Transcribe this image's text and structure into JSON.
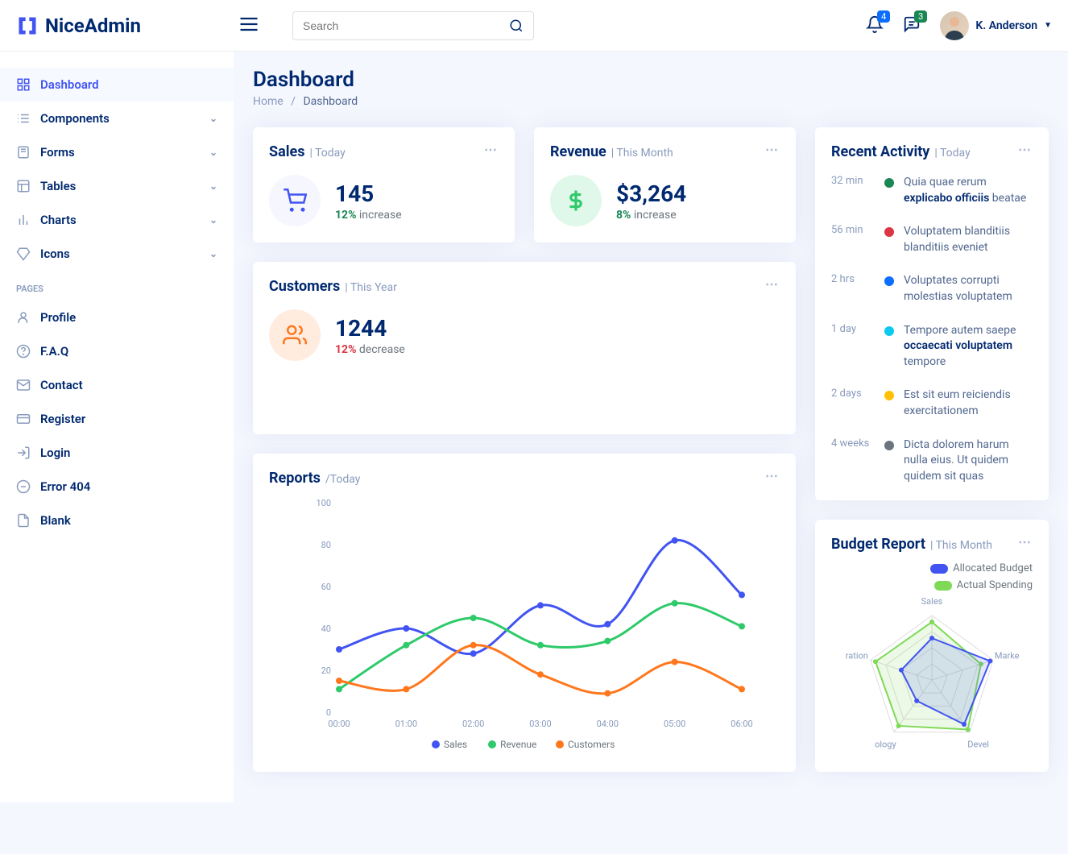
{
  "brand": "NiceAdmin",
  "search": {
    "placeholder": "Search"
  },
  "notifications": {
    "count": "4"
  },
  "messages": {
    "count": "3"
  },
  "user": {
    "name": "K. Anderson"
  },
  "sidebar": {
    "items": [
      {
        "label": "Dashboard",
        "icon": "grid",
        "active": true
      },
      {
        "label": "Components",
        "icon": "menu",
        "chevron": true
      },
      {
        "label": "Forms",
        "icon": "journal",
        "chevron": true
      },
      {
        "label": "Tables",
        "icon": "layout",
        "chevron": true
      },
      {
        "label": "Charts",
        "icon": "bar",
        "chevron": true
      },
      {
        "label": "Icons",
        "icon": "gem",
        "chevron": true
      }
    ],
    "pages_heading": "PAGES",
    "pages": [
      {
        "label": "Profile",
        "icon": "person"
      },
      {
        "label": "F.A.Q",
        "icon": "question"
      },
      {
        "label": "Contact",
        "icon": "envelope"
      },
      {
        "label": "Register",
        "icon": "card"
      },
      {
        "label": "Login",
        "icon": "login"
      },
      {
        "label": "Error 404",
        "icon": "dash"
      },
      {
        "label": "Blank",
        "icon": "file"
      }
    ]
  },
  "page": {
    "title": "Dashboard",
    "breadcrumb_home": "Home",
    "breadcrumb_sep": "/",
    "breadcrumb_current": "Dashboard"
  },
  "cards": {
    "sales": {
      "title": "Sales",
      "period": "Today",
      "value": "145",
      "pct": "12%",
      "trend": "increase",
      "direction": "up"
    },
    "revenue": {
      "title": "Revenue",
      "period": "This Month",
      "value": "$3,264",
      "pct": "8%",
      "trend": "increase",
      "direction": "up"
    },
    "customers": {
      "title": "Customers",
      "period": "This Year",
      "value": "1244",
      "pct": "12%",
      "trend": "decrease",
      "direction": "down"
    }
  },
  "reports": {
    "title": "Reports",
    "period": "/Today"
  },
  "activity": {
    "title": "Recent Activity",
    "period": "Today",
    "items": [
      {
        "time": "32 min",
        "color": "#198754",
        "text": "Quia quae rerum <strong>explicabo officiis</strong> beatae"
      },
      {
        "time": "56 min",
        "color": "#dc3545",
        "text": "Voluptatem blanditiis blanditiis eveniet"
      },
      {
        "time": "2 hrs",
        "color": "#0d6efd",
        "text": "Voluptates corrupti molestias voluptatem"
      },
      {
        "time": "1 day",
        "color": "#0dcaf0",
        "text": "Tempore autem saepe <strong>occaecati voluptatem</strong> tempore"
      },
      {
        "time": "2 days",
        "color": "#ffc107",
        "text": "Est sit eum reiciendis exercitationem"
      },
      {
        "time": "4 weeks",
        "color": "#6c757d",
        "text": "Dicta dolorem harum nulla eius. Ut quidem quidem sit quas"
      }
    ]
  },
  "budget": {
    "title": "Budget Report",
    "period": "This Month",
    "legend": [
      {
        "label": "Allocated Budget",
        "color": "#4154f1"
      },
      {
        "label": "Actual Spending",
        "color": "#7ed957"
      }
    ],
    "axes": [
      "Sales",
      "Marke",
      "Devel",
      "ology",
      "ration"
    ]
  },
  "chart_data": {
    "type": "line",
    "x": [
      "00:00",
      "01:00",
      "02:00",
      "03:00",
      "04:00",
      "05:00",
      "06:00"
    ],
    "ylim": [
      0,
      100
    ],
    "yticks": [
      0,
      20,
      40,
      60,
      80,
      100
    ],
    "series": [
      {
        "name": "Sales",
        "color": "#4154f1",
        "values": [
          30,
          40,
          28,
          51,
          42,
          82,
          56
        ]
      },
      {
        "name": "Revenue",
        "color": "#2eca6a",
        "values": [
          11,
          32,
          45,
          32,
          34,
          52,
          41
        ]
      },
      {
        "name": "Customers",
        "color": "#ff771d",
        "values": [
          15,
          11,
          32,
          18,
          9,
          24,
          11
        ]
      }
    ]
  }
}
